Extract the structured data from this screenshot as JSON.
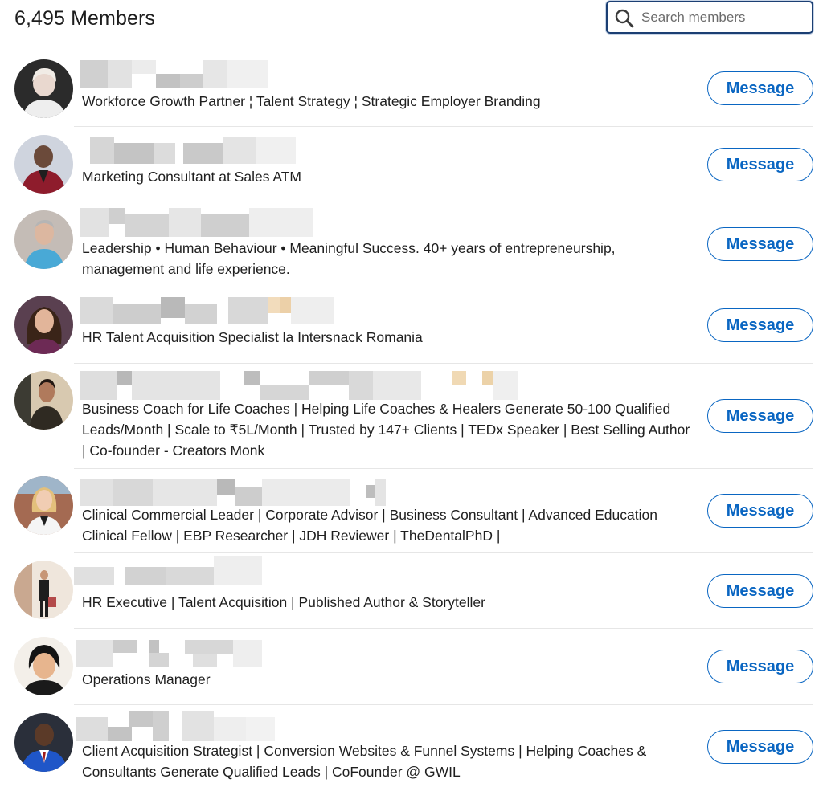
{
  "header": {
    "title": "6,495 Members",
    "search_placeholder": "Search members"
  },
  "members": [
    {
      "headline": "Workforce Growth Partner ¦ Talent Strategy ¦ Strategic Employer Branding",
      "button": "Message"
    },
    {
      "headline": "Marketing Consultant at Sales ATM",
      "button": "Message"
    },
    {
      "headline": "Leadership • Human Behaviour • Meaningful Success. 40+ years of entrepreneurship, management and life experience.",
      "button": "Message"
    },
    {
      "headline": "HR Talent Acquisition Specialist la Intersnack Romania",
      "button": "Message"
    },
    {
      "headline": "Business Coach for Life Coaches | Helping Life Coaches & Healers Generate 50-100 Qualified Leads/Month | Scale to ₹5L/Month | Trusted by 147+ Clients | TEDx Speaker | Best Selling Author | Co-founder - Creators Monk",
      "button": "Message"
    },
    {
      "headline": "Clinical Commercial Leader | Corporate Advisor | Business Consultant | Advanced Education Clinical Fellow | EBP Researcher | JDH Reviewer | TheDentalPhD |",
      "button": "Message"
    },
    {
      "headline": "HR Executive | Talent Acquisition | Published Author & Storyteller",
      "button": "Message"
    },
    {
      "headline": "Operations Manager",
      "button": "Message"
    },
    {
      "headline": "Client Acquisition Strategist | Conversion Websites & Funnel Systems | Helping Coaches & Consultants Generate Qualified Leads | CoFounder @ GWIL",
      "button": "Message"
    }
  ],
  "colors": {
    "accent": "#0a66c2",
    "search_border": "#1b3f73",
    "divider": "#e6e6e6"
  }
}
